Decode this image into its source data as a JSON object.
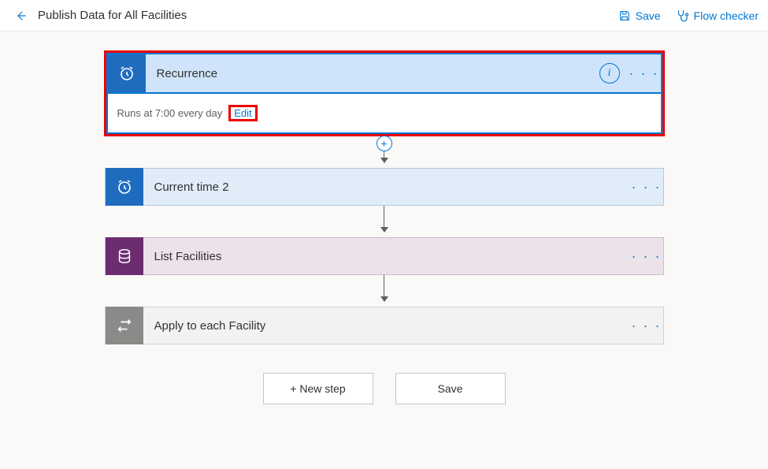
{
  "header": {
    "title": "Publish Data for All Facilities",
    "save_label": "Save",
    "flow_checker_label": "Flow checker"
  },
  "recurrence": {
    "label": "Recurrence",
    "body_text": "Runs at 7:00 every day",
    "edit_label": "Edit"
  },
  "steps": [
    {
      "id": "current_time",
      "label": "Current time 2",
      "icon": "clock",
      "theme": "blue"
    },
    {
      "id": "list_facilities",
      "label": "List Facilities",
      "icon": "db",
      "theme": "purple"
    },
    {
      "id": "apply_each",
      "label": "Apply to each Facility",
      "icon": "loop",
      "theme": "grey"
    }
  ],
  "buttons": {
    "new_step": "+ New step",
    "save": "Save"
  },
  "icons": {
    "ellipsis": "· · ·",
    "plus": "+",
    "info": "i"
  }
}
